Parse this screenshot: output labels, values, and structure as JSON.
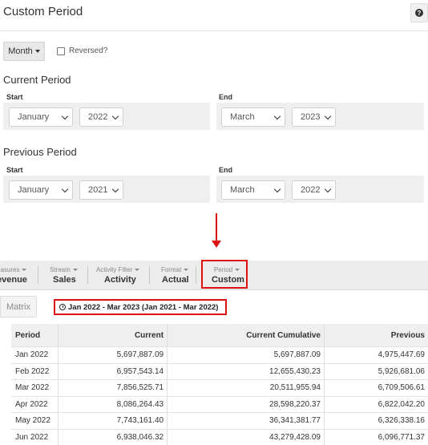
{
  "header": {
    "title": "Custom Period",
    "help_glyph": "?"
  },
  "controls": {
    "granularity": "Month",
    "reversed_label": "Reversed?",
    "reversed_checked": false
  },
  "current_period": {
    "title": "Current Period",
    "start_label": "Start",
    "end_label": "End",
    "start_month": "January",
    "start_year": "2022",
    "end_month": "March",
    "end_year": "2023"
  },
  "previous_period": {
    "title": "Previous Period",
    "start_label": "Start",
    "end_label": "End",
    "start_month": "January",
    "start_year": "2021",
    "end_month": "March",
    "end_year": "2022"
  },
  "toolbar": {
    "items": [
      {
        "top": "easures",
        "value": "evenue"
      },
      {
        "top": "Stream",
        "value": "Sales"
      },
      {
        "top": "Activity Filter",
        "value": "Activity"
      },
      {
        "top": "Format",
        "value": "Actual"
      },
      {
        "top": "Period",
        "value": "Custom"
      }
    ]
  },
  "matrix_label": "Matrix",
  "date_range": "Jan 2022 - Mar 2023 (Jan 2021 - Mar 2022)",
  "table": {
    "headers": [
      "Period",
      "Current",
      "Current Cumulative",
      "Previous"
    ],
    "rows": [
      [
        "Jan 2022",
        "5,697,887.09",
        "5,697,887.09",
        "4,975,447.69"
      ],
      [
        "Feb 2022",
        "6,957,543.14",
        "12,655,430.23",
        "5,926,681.06"
      ],
      [
        "Mar 2022",
        "7,856,525.71",
        "20,511,955.94",
        "6,709,506.61"
      ],
      [
        "Apr 2022",
        "8,086,264.43",
        "28,598,220.37",
        "6,822,042.20"
      ],
      [
        "May 2022",
        "7,743,161.40",
        "36,341,381.77",
        "6,326,338.16"
      ],
      [
        "Jun 2022",
        "6,938,046.32",
        "43,279,428.09",
        "6,096,771.37"
      ]
    ]
  },
  "colors": {
    "highlight": "#dd1111",
    "panel": "#efefef",
    "toolbar": "#ececec"
  }
}
